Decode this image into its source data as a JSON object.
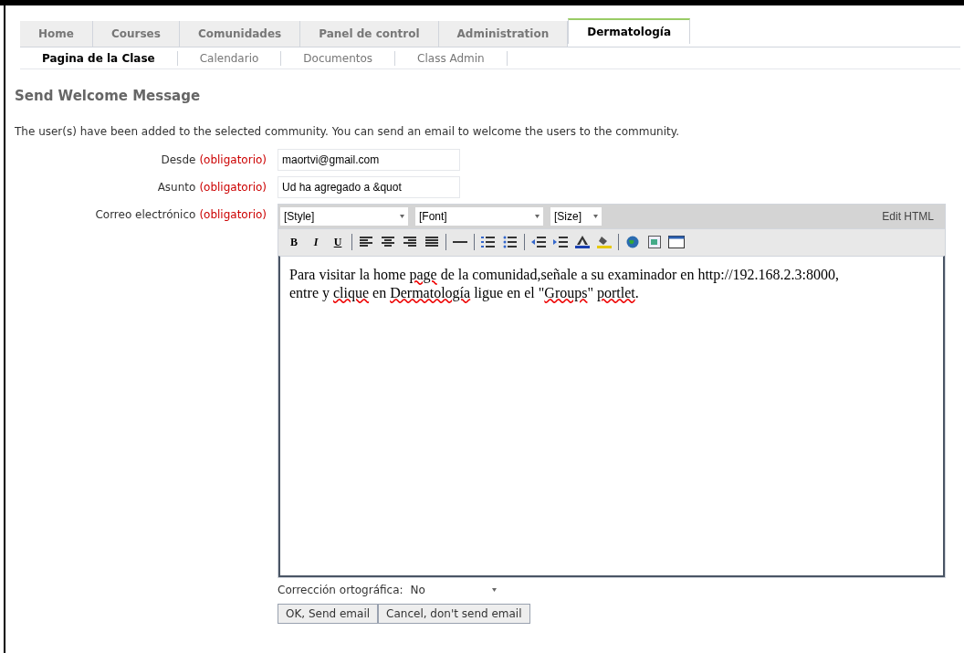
{
  "tabs": [
    {
      "label": "Home",
      "selected": false
    },
    {
      "label": "Courses",
      "selected": false
    },
    {
      "label": "Comunidades",
      "selected": false
    },
    {
      "label": "Panel de control",
      "selected": false
    },
    {
      "label": "Administration",
      "selected": false
    },
    {
      "label": "Dermatología",
      "selected": true
    }
  ],
  "subtabs": [
    {
      "label": "Pagina de la Clase",
      "selected": true
    },
    {
      "label": "Calendario",
      "selected": false
    },
    {
      "label": "Documentos",
      "selected": false
    },
    {
      "label": "Class Admin",
      "selected": false
    }
  ],
  "heading": "Send Welcome Message",
  "intro": "The user(s) have been added to the selected community. You can send an email to welcome the users to the community.",
  "fields": [
    {
      "label": "Desde",
      "required": "(obligatorio)",
      "value": "maortvi@gmail.com"
    },
    {
      "label": "Asunto",
      "required": "(obligatorio)",
      "value": "Ud ha agregado a &quot"
    }
  ],
  "editor": {
    "label": "Correo electrónico",
    "required": "(obligatorio)",
    "dropdowns": [
      {
        "value": "[Style]"
      },
      {
        "value": "[Font]"
      },
      {
        "value": "[Size]"
      }
    ],
    "edit_html": "Edit HTML",
    "format_buttons": [
      "B",
      "I",
      "U"
    ],
    "content": [
      {
        "text": "Para visitar la home ",
        "misspelled": false
      },
      {
        "text": "page",
        "misspelled": true
      },
      {
        "text": " de la comunidad,señale a su examinador en http://192.168.2.3:8000, entre y ",
        "misspelled": false
      },
      {
        "text": "clique",
        "misspelled": true
      },
      {
        "text": " en ",
        "misspelled": false
      },
      {
        "text": "Dermatología",
        "misspelled": true
      },
      {
        "text": " ligue en el \"",
        "misspelled": false
      },
      {
        "text": "Groups",
        "misspelled": true
      },
      {
        "text": "\" ",
        "misspelled": false
      },
      {
        "text": "portlet",
        "misspelled": true
      },
      {
        "text": ".",
        "misspelled": false
      }
    ]
  },
  "spellcheck": {
    "label": "Corrección ortográfica:",
    "value": "No"
  },
  "buttons": [
    "OK, Send email",
    "Cancel, don't send email"
  ]
}
